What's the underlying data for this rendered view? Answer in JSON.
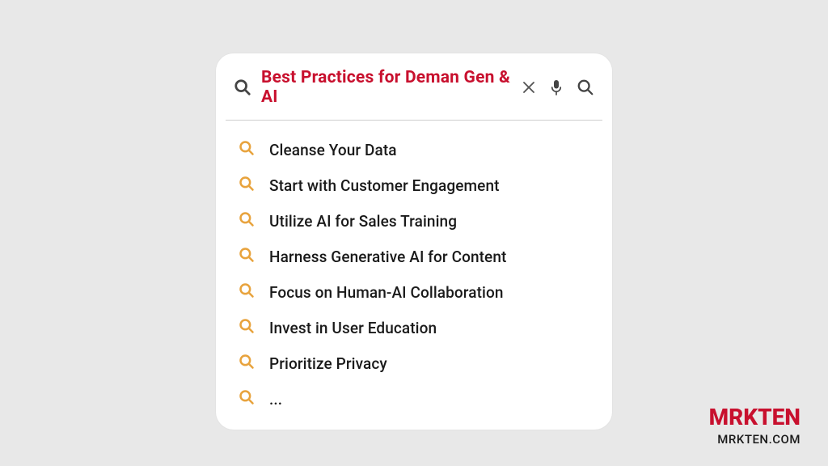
{
  "search": {
    "title": "Best Practices for Deman Gen & AI",
    "suggestions": [
      "Cleanse Your Data",
      "Start with Customer Engagement",
      "Utilize AI for Sales Training",
      "Harness Generative AI for Content",
      "Focus on Human-AI Collaboration",
      "Invest in User Education",
      "Prioritize Privacy",
      "..."
    ]
  },
  "brand": {
    "name": "MRKTEN",
    "url": "MRKTEN.COM"
  },
  "colors": {
    "accent_red": "#c8102e",
    "accent_orange": "#e8a33d",
    "icon_gray": "#555"
  }
}
